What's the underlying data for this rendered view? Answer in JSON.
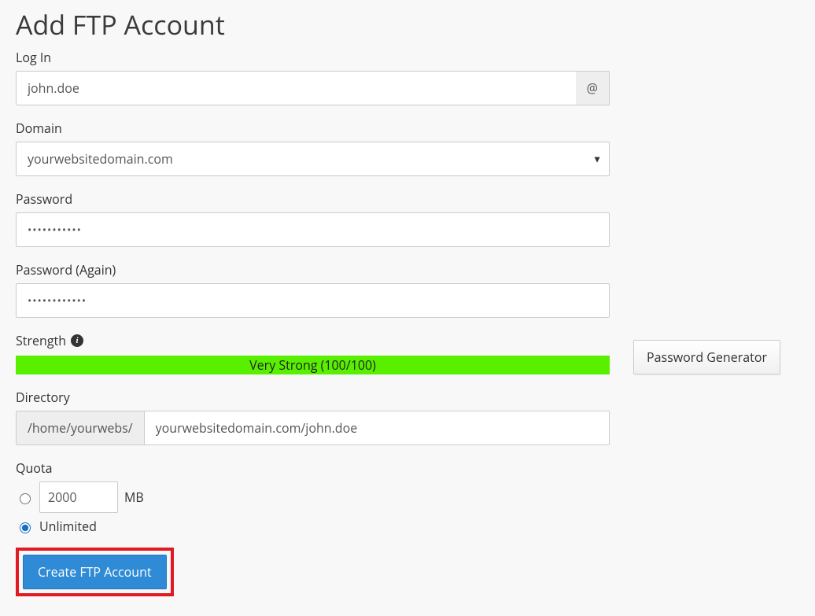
{
  "title": "Add FTP Account",
  "login": {
    "label": "Log In",
    "value": "john.doe",
    "addon": "@"
  },
  "domain": {
    "label": "Domain",
    "value": "yourwebsitedomain.com"
  },
  "password": {
    "label": "Password",
    "value": "•••••••••••"
  },
  "password2": {
    "label": "Password (Again)",
    "value": "••••••••••••"
  },
  "strength": {
    "label": "Strength",
    "text": "Very Strong (100/100)",
    "generator_label": "Password Generator"
  },
  "directory": {
    "label": "Directory",
    "prefix": "/home/yourwebs/",
    "value": "yourwebsitedomain.com/john.doe"
  },
  "quota": {
    "label": "Quota",
    "mb_value": "2000",
    "mb_unit": "MB",
    "unlimited_label": "Unlimited"
  },
  "submit": {
    "label": "Create FTP Account"
  }
}
